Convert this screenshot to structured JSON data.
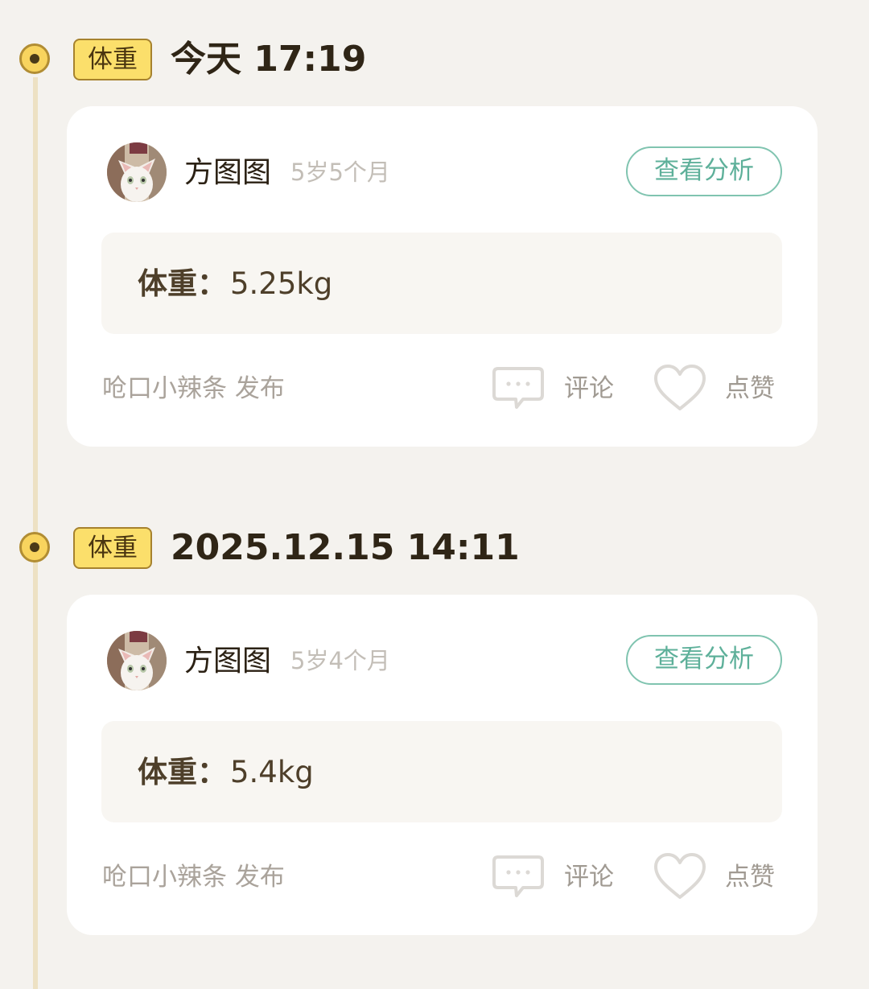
{
  "entries": [
    {
      "tag": "体重",
      "time": "今天 17:19",
      "pet_name": "方图图",
      "pet_age": "5岁5个月",
      "analysis_button": "查看分析",
      "record_label": "体重：",
      "record_value": "5.25kg",
      "publisher": "呛口小辣条 发布",
      "comment_label": "评论",
      "like_label": "点赞"
    },
    {
      "tag": "体重",
      "time": "2025.12.15 14:11",
      "pet_name": "方图图",
      "pet_age": "5岁4个月",
      "analysis_button": "查看分析",
      "record_label": "体重：",
      "record_value": "5.4kg",
      "publisher": "呛口小辣条 发布",
      "comment_label": "评论",
      "like_label": "点赞"
    }
  ],
  "icons": {
    "timeline_dot": "timeline-dot-icon",
    "comment": "comment-icon",
    "like": "heart-icon",
    "avatar": "cat-avatar"
  },
  "colors": {
    "background": "#f4f2ee",
    "badge": "#fbdf6b",
    "accent": "#5eb09a",
    "card": "#ffffff"
  }
}
